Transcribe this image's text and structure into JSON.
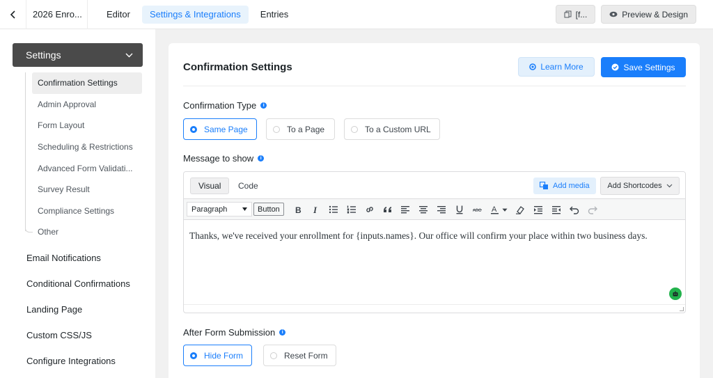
{
  "topbar": {
    "form_name": "2026 Enro...",
    "tabs": [
      {
        "label": "Editor"
      },
      {
        "label": "Settings & Integrations"
      },
      {
        "label": "Entries"
      }
    ],
    "shortcode_button": "[f...",
    "preview_button": "Preview & Design"
  },
  "sidebar": {
    "settings_label": "Settings",
    "sub_items": [
      {
        "label": "Confirmation Settings"
      },
      {
        "label": "Admin Approval"
      },
      {
        "label": "Form Layout"
      },
      {
        "label": "Scheduling & Restrictions"
      },
      {
        "label": "Advanced Form Validati..."
      },
      {
        "label": "Survey Result"
      },
      {
        "label": "Compliance Settings"
      },
      {
        "label": "Other"
      }
    ],
    "main_items": [
      {
        "label": "Email Notifications"
      },
      {
        "label": "Conditional Confirmations"
      },
      {
        "label": "Landing Page"
      },
      {
        "label": "Custom CSS/JS"
      },
      {
        "label": "Configure Integrations"
      }
    ]
  },
  "panel": {
    "title": "Confirmation Settings",
    "learn_more": "Learn More",
    "save_settings": "Save Settings",
    "confirmation_type": {
      "label": "Confirmation Type",
      "options": [
        {
          "label": "Same Page"
        },
        {
          "label": "To a Page"
        },
        {
          "label": "To a Custom URL"
        }
      ]
    },
    "message": {
      "label": "Message to show",
      "tab_visual": "Visual",
      "tab_code": "Code",
      "add_media": "Add media",
      "add_shortcodes": "Add Shortcodes",
      "format_select": "Paragraph",
      "button_label": "Button",
      "body": "Thanks, we've received your enrollment for {inputs.names}. Our office will confirm your place within two business days."
    },
    "after_submission": {
      "label": "After Form Submission",
      "options": [
        {
          "label": "Hide Form"
        },
        {
          "label": "Reset Form"
        }
      ]
    }
  },
  "colors": {
    "accent": "#1a7efb",
    "sidebar_active": "#4a4a4a"
  }
}
